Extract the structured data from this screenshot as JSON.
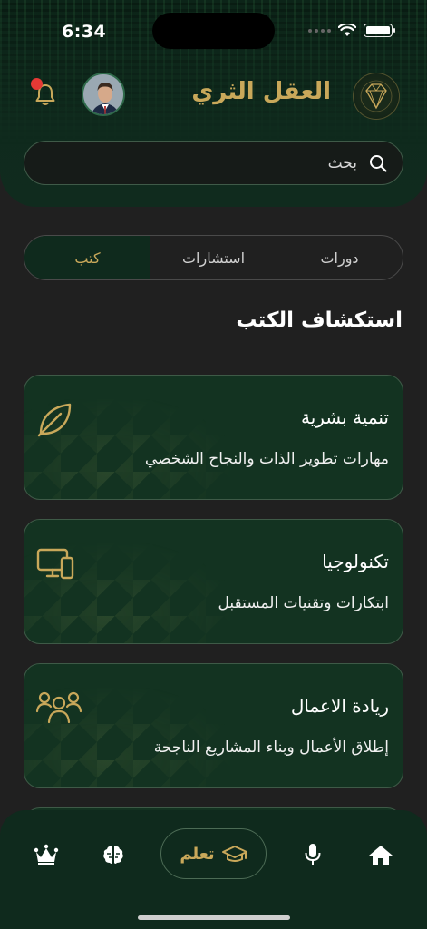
{
  "status_bar": {
    "time": "6:34"
  },
  "header": {
    "app_title": "العقل الثري",
    "logo": "diamond-brain-emblem",
    "avatar": "user-avatar",
    "notification_dot_color": "#e53935"
  },
  "search": {
    "placeholder": "بحث",
    "value": ""
  },
  "tabs": [
    {
      "label": "دورات",
      "active": false
    },
    {
      "label": "استشارات",
      "active": false
    },
    {
      "label": "كتب",
      "active": true
    }
  ],
  "section_title": "استكشاف الكتب",
  "cards": [
    {
      "title": "تنمية بشرية",
      "subtitle": "مهارات تطوير الذات والنجاح الشخصي",
      "icon": "leaf-icon"
    },
    {
      "title": "تكنولوجيا",
      "subtitle": "ابتكارات وتقنيات المستقبل",
      "icon": "devices-icon"
    },
    {
      "title": "ريادة الاعمال",
      "subtitle": "إطلاق الأعمال وبناء المشاريع الناجحة",
      "icon": "team-icon"
    }
  ],
  "bottom_nav": {
    "items": [
      "crown-icon",
      "brain-icon",
      "learn",
      "microphone-icon",
      "home-icon"
    ],
    "learn_label": "تعلم"
  },
  "colors": {
    "accent_gold": "#c9a85a",
    "dark_green": "#0f2a1d",
    "background": "#202020"
  }
}
